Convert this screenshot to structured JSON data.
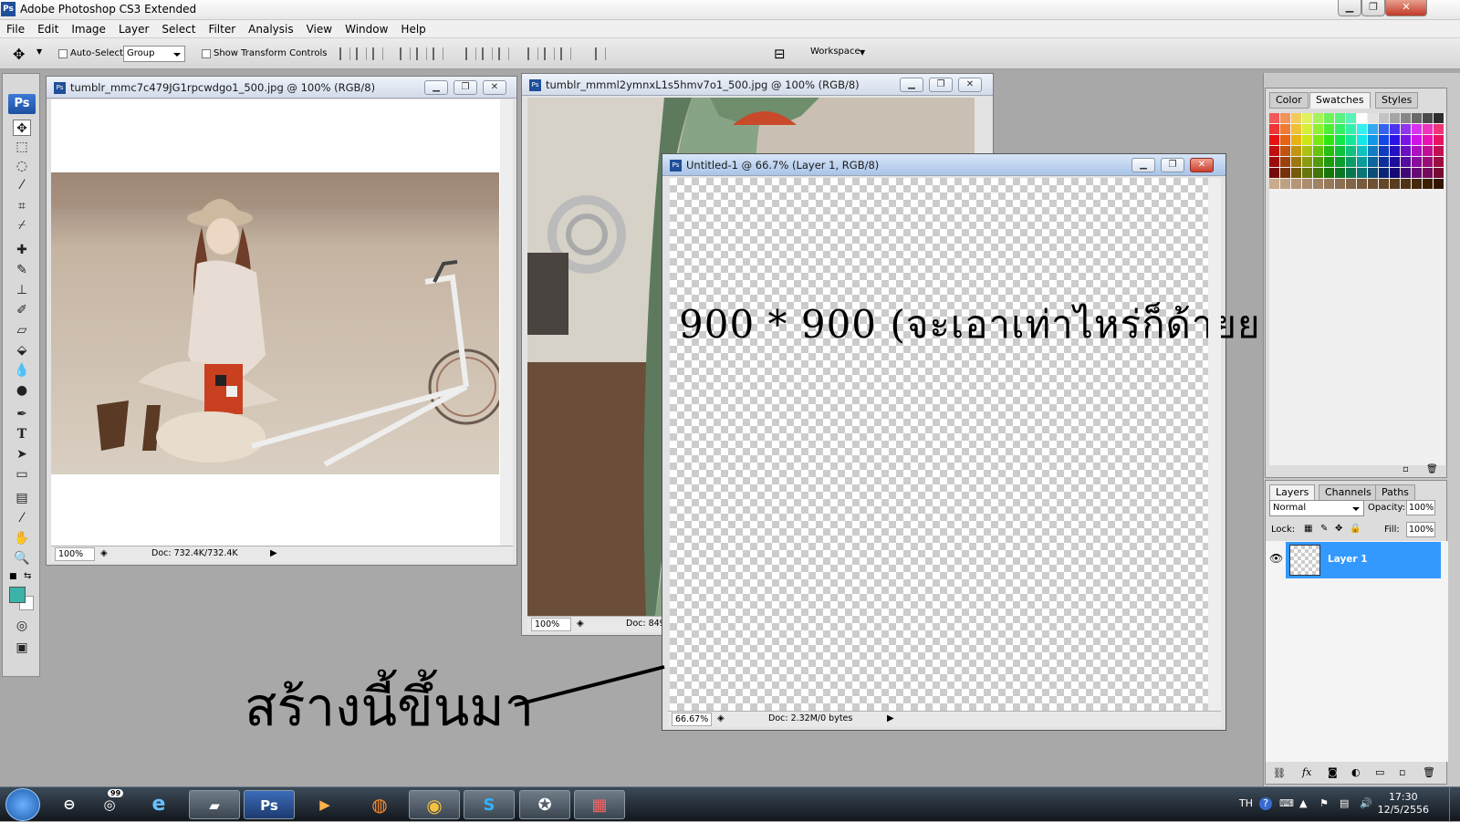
{
  "app": {
    "icon_text": "Ps",
    "title": "Adobe Photoshop CS3 Extended"
  },
  "window_controls": {
    "minimize": "▁",
    "restore": "❐",
    "close": "✕"
  },
  "menu": [
    "File",
    "Edit",
    "Image",
    "Layer",
    "Select",
    "Filter",
    "Analysis",
    "View",
    "Window",
    "Help"
  ],
  "options": {
    "auto_select_label": "Auto-Select:",
    "auto_select_value": "Group",
    "show_transform_label": "Show Transform Controls",
    "workspace_label": "Workspace"
  },
  "toolbox": {
    "logo": "Ps"
  },
  "doc1": {
    "title": "tumblr_mmc7c479JG1rpcwdgo1_500.jpg @ 100% (RGB/8)",
    "zoom": "100%",
    "doc_info": "Doc: 732.4K/732.4K"
  },
  "doc2": {
    "title": "tumblr_mmml2ymnxL1s5hmv7o1_500.jpg @ 100% (RGB/8)",
    "zoom": "100%",
    "doc_info": "Doc: 849"
  },
  "doc3": {
    "title": "Untitled-1 @ 66.7% (Layer 1, RGB/8)",
    "zoom": "66.67%",
    "doc_info": "Doc: 2.32M/0 bytes",
    "canvas_text": "900 * 900 (จะเอาเท่าไหร่ก็ด้ายย)"
  },
  "annotation": {
    "text": "สร้างนี้ขึ้นมา"
  },
  "swatches_panel": {
    "tabs": [
      "Color",
      "Swatches",
      "Styles"
    ]
  },
  "layers_panel": {
    "tabs": [
      "Layers",
      "Channels",
      "Paths"
    ],
    "blend_mode": "Normal",
    "opacity_label": "Opacity:",
    "opacity_value": "100%",
    "lock_label": "Lock:",
    "fill_label": "Fill:",
    "fill_value": "100%",
    "layers": [
      {
        "name": "Layer 1",
        "visible": true,
        "selected": true
      }
    ]
  },
  "taskbar": {
    "badge": "99",
    "lang": "TH",
    "time": "17:30",
    "date": "12/5/2556",
    "ps_label": "Ps"
  },
  "colors": {
    "accent_selection": "#3399ff",
    "foreground_color": "#3bb3a8",
    "taskbar": "#1a222b"
  }
}
